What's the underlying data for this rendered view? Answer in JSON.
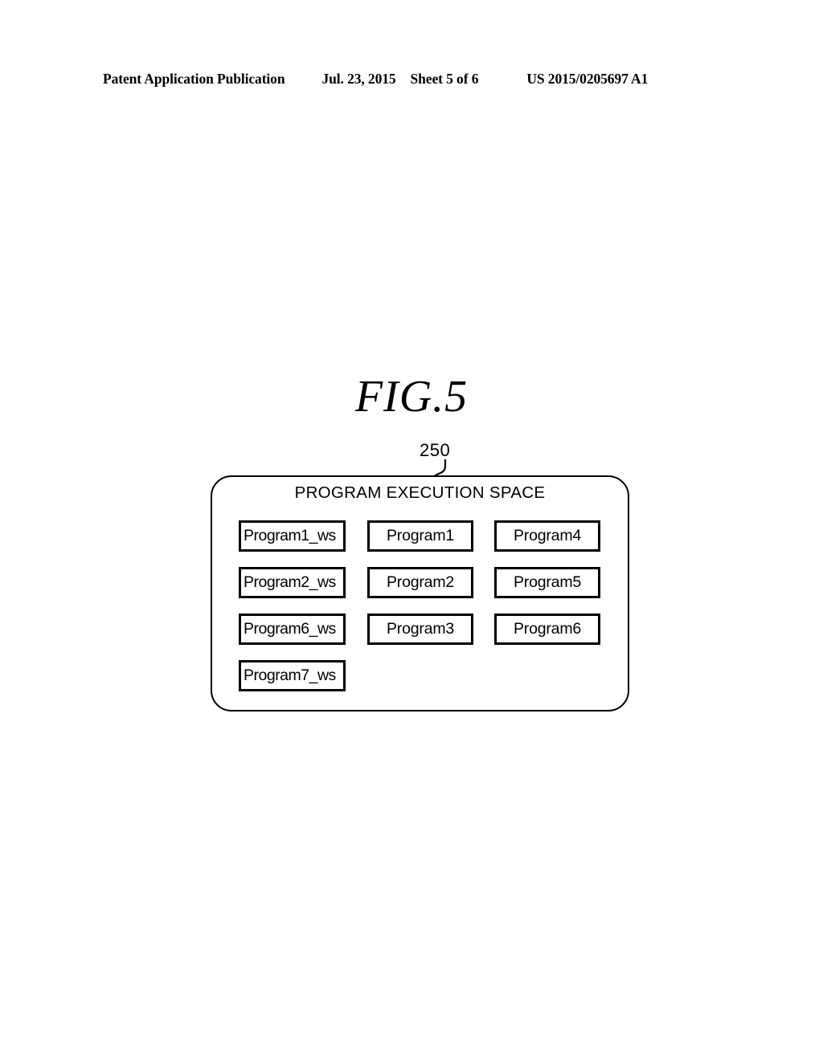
{
  "header": {
    "publication": "Patent Application Publication",
    "date": "Jul. 23, 2015",
    "sheet": "Sheet 5 of 6",
    "patent_number": "US 2015/0205697 A1"
  },
  "figure": {
    "title": "FIG.5",
    "reference_numeral": "250"
  },
  "diagram": {
    "container_label": "PROGRAM EXECUTION SPACE",
    "rows": [
      {
        "col1": "Program1_ws",
        "col2": "Program1",
        "col3": "Program4"
      },
      {
        "col1": "Program2_ws",
        "col2": "Program2",
        "col3": "Program5"
      },
      {
        "col1": "Program6_ws",
        "col2": "Program3",
        "col3": "Program6"
      },
      {
        "col1": "Program7_ws",
        "col2": "",
        "col3": ""
      }
    ]
  },
  "colors": {
    "ink": "#000000",
    "paper": "#ffffff"
  }
}
